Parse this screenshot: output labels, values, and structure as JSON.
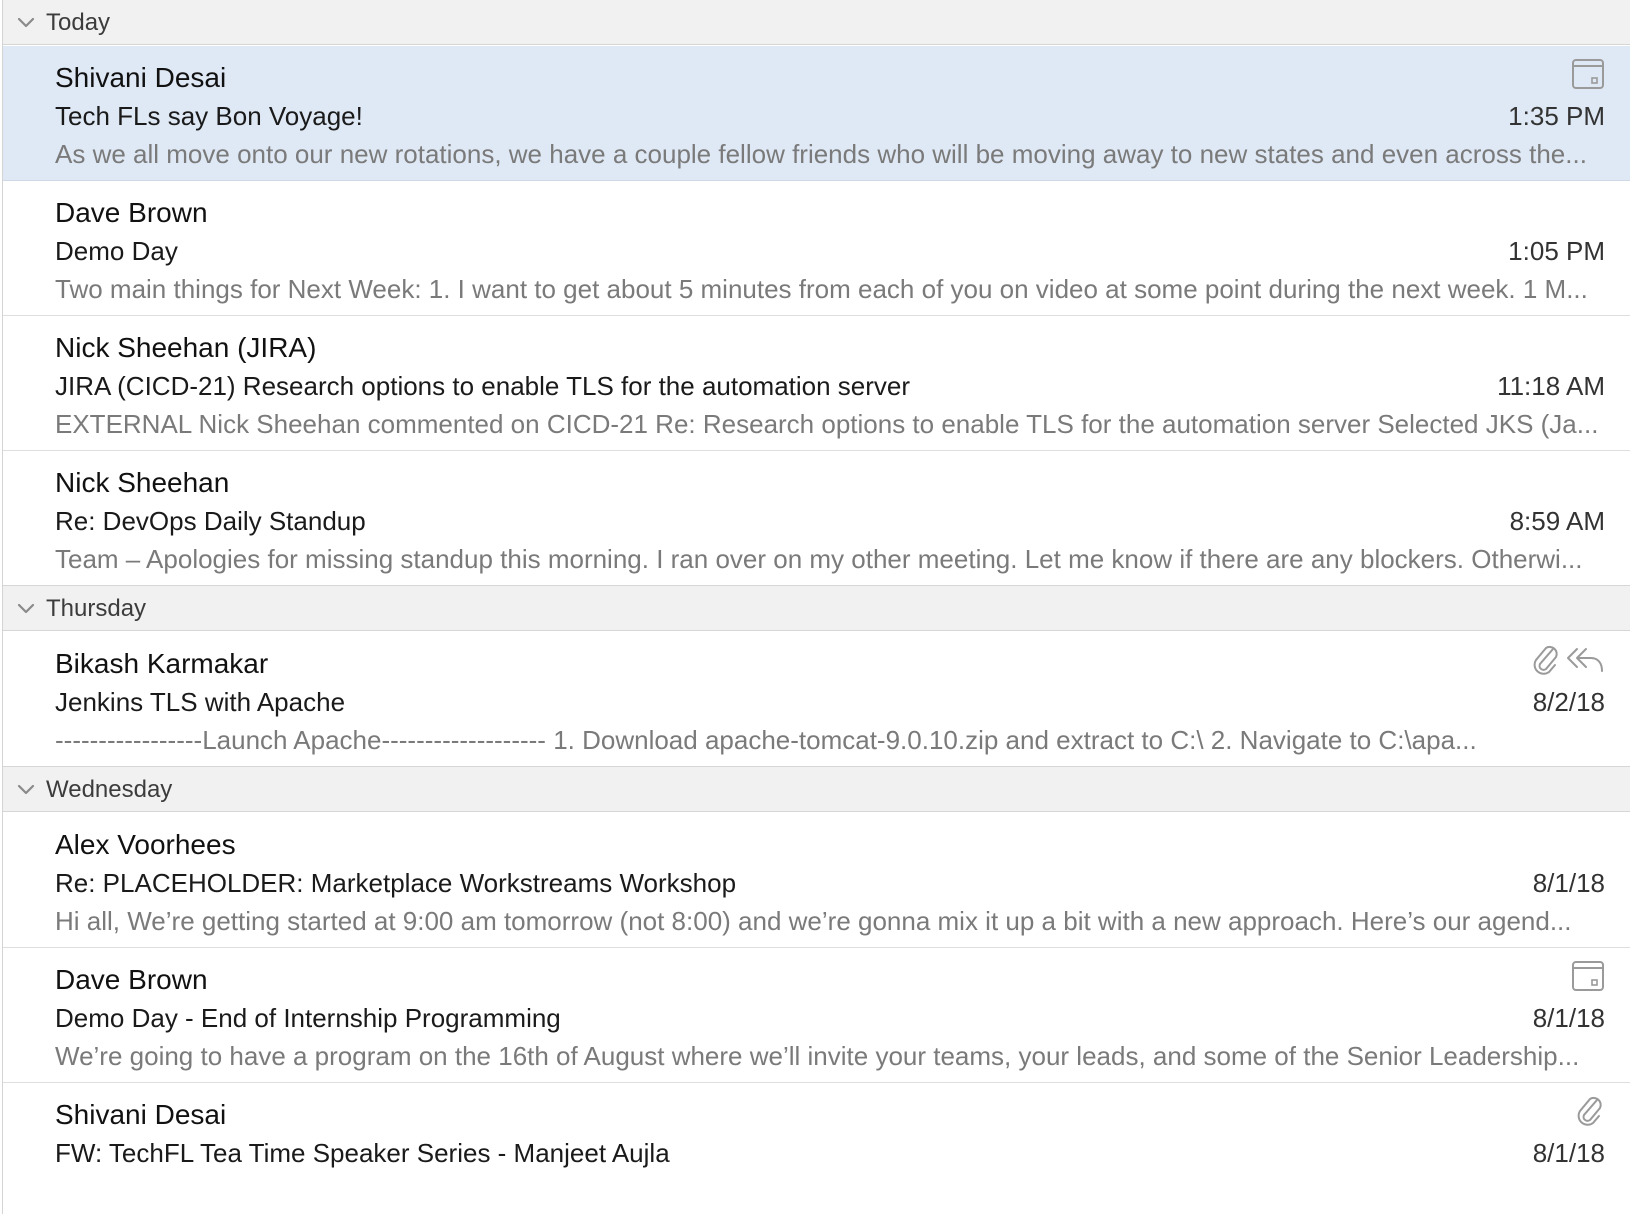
{
  "groups": [
    {
      "title": "Today",
      "messages": [
        {
          "sender": "Shivani Desai",
          "subject": "Tech FLs say Bon Voyage!",
          "time": "1:35 PM",
          "preview": "As we all move onto our new rotations, we have a couple fellow friends who will be moving away to new states and even across the...",
          "selected": true,
          "icons": [
            "calendar-icon"
          ]
        },
        {
          "sender": "Dave Brown",
          "subject": "Demo Day",
          "time": "1:05 PM",
          "preview": "Two main things for Next Week: 1. I want to get about 5 minutes from each of you on video at some point during the next week. 1 M...",
          "selected": false,
          "icons": []
        },
        {
          "sender": "Nick Sheehan (JIRA)",
          "subject": "JIRA (CICD-21) Research options to enable TLS for the automation server",
          "time": "11:18 AM",
          "preview": "EXTERNAL Nick Sheehan commented on CICD-21 Re: Research options to enable TLS for the automation server Selected JKS (Ja...",
          "selected": false,
          "icons": []
        },
        {
          "sender": "Nick Sheehan",
          "subject": "Re: DevOps Daily Standup",
          "time": "8:59 AM",
          "preview": "Team – Apologies for missing standup this morning. I ran over on my other meeting. Let me know if there are any blockers. Otherwi...",
          "selected": false,
          "icons": []
        }
      ]
    },
    {
      "title": "Thursday",
      "messages": [
        {
          "sender": "Bikash Karmakar",
          "subject": "Jenkins TLS with Apache",
          "time": "8/2/18",
          "preview": "-----------------Launch Apache------------------- 1. Download apache-tomcat-9.0.10.zip and extract to C:\\ 2. Navigate to C:\\apa...",
          "selected": false,
          "icons": [
            "attachment-icon",
            "reply-all-icon"
          ]
        }
      ]
    },
    {
      "title": "Wednesday",
      "messages": [
        {
          "sender": "Alex Voorhees",
          "subject": "Re: PLACEHOLDER: Marketplace Workstreams Workshop",
          "time": "8/1/18",
          "preview": "Hi all, We’re getting started at 9:00 am tomorrow (not 8:00) and we’re gonna mix it up a bit with a new approach. Here’s our agend...",
          "selected": false,
          "icons": []
        },
        {
          "sender": "Dave Brown",
          "subject": "Demo Day - End of Internship Programming",
          "time": "8/1/18",
          "preview": "We’re going to have a program on the 16th of August where we’ll invite your teams, your leads, and some of the Senior Leadership...",
          "selected": false,
          "icons": [
            "calendar-icon"
          ]
        },
        {
          "sender": "Shivani Desai",
          "subject": "FW: TechFL Tea Time Speaker Series - Manjeet Aujla",
          "time": "8/1/18",
          "preview": "",
          "selected": false,
          "icons": [
            "attachment-icon"
          ]
        }
      ]
    }
  ],
  "colors": {
    "selected_bg": "#dfe9f5",
    "group_header_bg": "#f1f1f1",
    "preview_text": "#7a7a7a",
    "icon_stroke": "#9a9a9a"
  }
}
